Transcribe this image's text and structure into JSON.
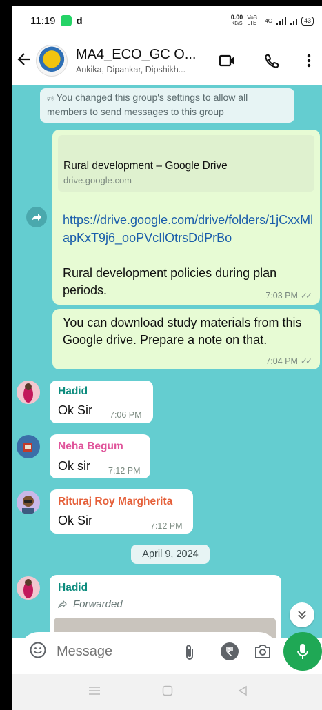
{
  "status_bar": {
    "time": "11:19",
    "app_letter": "d",
    "net_speed_top": "0.00",
    "net_speed_bottom": "KB/S",
    "volte": "VoB LTE",
    "network": "4G",
    "battery": "43"
  },
  "header": {
    "group_name": "MA4_ECO_GC O...",
    "members": "Ankika, Dipankar, Dipshikh..."
  },
  "messages": {
    "system": "You changed this group's settings to allow all members to send messages to this group",
    "link": {
      "card_title": "Rural development – Google Drive",
      "card_domain": "drive.google.com",
      "url": "https://drive.google.com/drive/folders/1jCxxMlapKxT9j6_ooPVcIlOtrsDdPrBo",
      "caption": "Rural development policies during plan periods.",
      "time": "7:03 PM"
    },
    "download_note": {
      "text": "You can download study materials from this Google drive. Prepare a note on that.",
      "time": "7:04 PM"
    },
    "hadid_1": {
      "sender": "Hadid",
      "text": "Ok Sir",
      "time": "7:06 PM"
    },
    "neha": {
      "sender": "Neha Begum",
      "text": "Ok sir",
      "time": "7:12 PM"
    },
    "rituraj": {
      "sender": "Rituraj Roy Margherita",
      "text": "Ok Sir",
      "time": "7:12 PM"
    },
    "date_chip": "April 9, 2024",
    "hadid_2": {
      "sender": "Hadid",
      "forwarded_label": "Forwarded"
    }
  },
  "sender_colors": {
    "hadid": "#0d8c7e",
    "neha": "#e0559b",
    "rituraj": "#e5603a"
  },
  "input": {
    "placeholder": "Message"
  },
  "colors": {
    "chat_background": "#64cdd0",
    "outgoing_bubble": "#e7fbd4",
    "link": "#1a5dab",
    "mic_button": "#1fa855"
  },
  "icons": [
    "back-arrow-icon",
    "video-call-icon",
    "voice-call-icon",
    "more-options-icon",
    "forward-icon",
    "emoji-icon",
    "attach-icon",
    "rupee-payment-icon",
    "camera-icon",
    "mic-icon",
    "scroll-down-icon",
    "nav-recents-icon",
    "nav-home-icon",
    "nav-back-icon"
  ]
}
